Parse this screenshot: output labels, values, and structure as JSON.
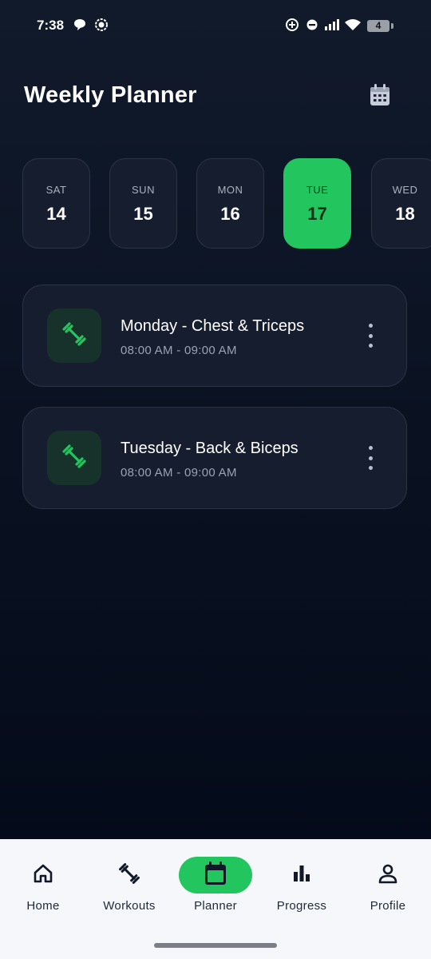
{
  "status_bar": {
    "time": "7:38",
    "battery": "4",
    "icons": [
      "chat-bubble-icon",
      "record-icon",
      "data-saver-icon",
      "do-not-disturb-icon",
      "signal-icon",
      "wifi-icon",
      "battery-icon"
    ]
  },
  "header": {
    "title": "Weekly Planner",
    "calendar_icon": "calendar-icon"
  },
  "days": [
    {
      "name": "SAT",
      "num": "14",
      "selected": false
    },
    {
      "name": "SUN",
      "num": "15",
      "selected": false
    },
    {
      "name": "MON",
      "num": "16",
      "selected": false
    },
    {
      "name": "TUE",
      "num": "17",
      "selected": true
    },
    {
      "name": "WED",
      "num": "18",
      "selected": false
    }
  ],
  "workouts": [
    {
      "title": "Monday - Chest & Triceps",
      "time": "08:00 AM - 09:00 AM",
      "icon": "dumbbell-icon"
    },
    {
      "title": "Tuesday - Back & Biceps",
      "time": "08:00 AM - 09:00 AM",
      "icon": "dumbbell-icon"
    }
  ],
  "nav": [
    {
      "label": "Home",
      "icon": "home-icon",
      "active": false
    },
    {
      "label": "Workouts",
      "icon": "dumbbell-icon",
      "active": false
    },
    {
      "label": "Planner",
      "icon": "calendar-icon",
      "active": true
    },
    {
      "label": "Progress",
      "icon": "bar-chart-icon",
      "active": false
    },
    {
      "label": "Profile",
      "icon": "person-icon",
      "active": false
    }
  ],
  "colors": {
    "accent": "#22c55e",
    "background_top": "#111a2b",
    "background_bottom": "#020816",
    "card": "#161d2e",
    "nav_background": "#f6f7fb"
  }
}
